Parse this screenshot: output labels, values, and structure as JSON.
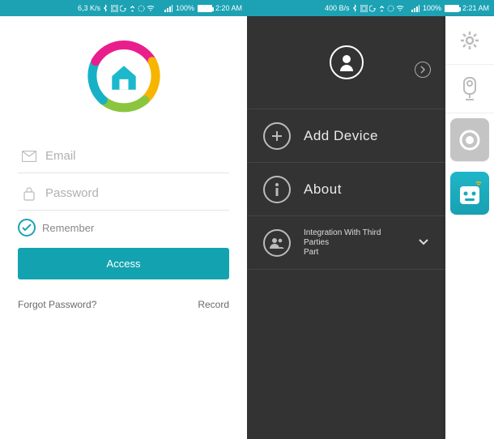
{
  "left": {
    "status": {
      "net_speed": "6,3 K/s",
      "battery_pct": "100%",
      "time": "2:20 AM"
    },
    "email_placeholder": "Email",
    "password_placeholder": "Password",
    "remember_label": "Remember",
    "access_label": "Access",
    "forgot_label": "Forgot Password?",
    "record_label": "Record"
  },
  "right": {
    "status": {
      "net_speed": "400 B/s",
      "battery_pct": "100%",
      "time": "2:21 AM"
    },
    "menu": {
      "add_device": "Add Device",
      "about": "About",
      "integration_line1": "Integration With Third Parties",
      "integration_line2": "Part"
    }
  }
}
